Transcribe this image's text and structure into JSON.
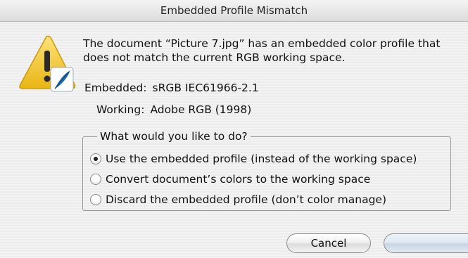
{
  "window": {
    "title": "Embedded Profile Mismatch"
  },
  "message": "The document “Picture 7.jpg” has an embedded color profile that does not match the current RGB working space.",
  "profiles": {
    "embedded_label": "Embedded:",
    "embedded_value": "sRGB IEC61966-2.1",
    "working_label": "Working:",
    "working_value": "Adobe RGB (1998)"
  },
  "options": {
    "legend": "What would you like to do?",
    "items": [
      {
        "label": "Use the embedded profile (instead of the working space)",
        "checked": true
      },
      {
        "label": "Convert document’s colors to the working space",
        "checked": false
      },
      {
        "label": "Discard the embedded profile (don’t color manage)",
        "checked": false
      }
    ]
  },
  "buttons": {
    "cancel": "Cancel",
    "ok": ""
  },
  "icons": {
    "alert": "warning-triangle-icon",
    "app_badge": "feather-icon"
  },
  "colors": {
    "warning": "#f2c21a",
    "feather": "#2a6fb3"
  }
}
